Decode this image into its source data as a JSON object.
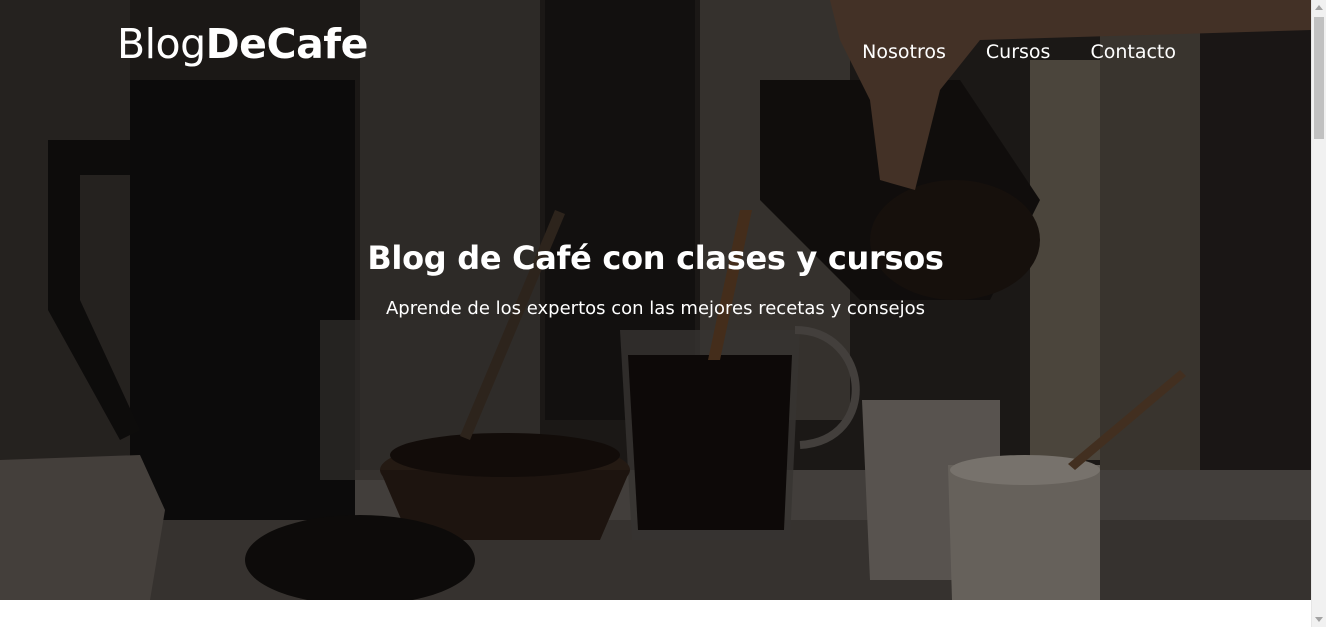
{
  "header": {
    "logo_light": "Blog",
    "logo_bold": "DeCafe"
  },
  "nav": {
    "items": [
      {
        "label": "Nosotros"
      },
      {
        "label": "Cursos"
      },
      {
        "label": "Contacto"
      }
    ]
  },
  "hero": {
    "title": "Blog de Café con clases y cursos",
    "subtitle": "Aprende de los expertos con las mejores recetas y consejos"
  },
  "colors": {
    "text": "#ffffff",
    "overlay": "rgba(0,0,0,0.38)"
  }
}
